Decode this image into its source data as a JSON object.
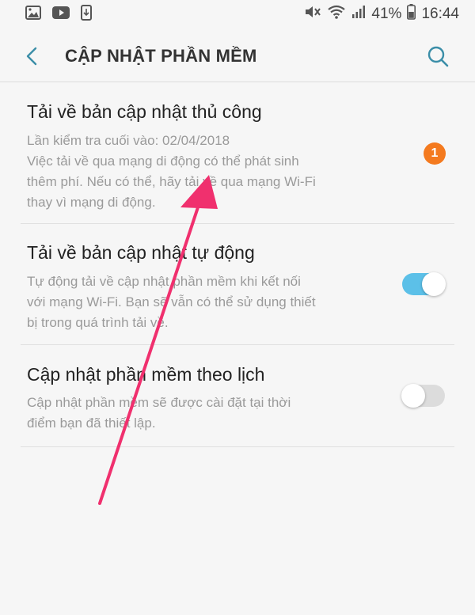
{
  "status_bar": {
    "battery_percent": "41%",
    "time": "16:44",
    "left_icons": [
      "gallery-icon",
      "youtube-icon",
      "update-phone-icon"
    ],
    "right_icons": [
      "mute-icon",
      "wifi-icon",
      "signal-icon",
      "battery-icon"
    ]
  },
  "header": {
    "title": "CẬP NHẬT PHẦN MỀM",
    "back_icon": "back-icon",
    "search_icon": "search-icon"
  },
  "items": [
    {
      "title": "Tải về bản cập nhật thủ công",
      "lines": [
        "Lần kiểm tra cuối vào: 02/04/2018",
        "Việc tải về qua mạng di động có thể phát sinh",
        "thêm phí. Nếu có thể, hãy tải về qua mạng Wi-Fi",
        "thay vì mạng di động."
      ],
      "badge": "1",
      "badge_color": "#f47a1f"
    },
    {
      "title": "Tải về bản cập nhật tự động",
      "lines": [
        "Tự động tải về cập nhật phần mềm khi kết nối",
        "với mạng Wi-Fi. Bạn sẽ vẫn có thể sử dụng thiết",
        "bị trong quá trình tải về."
      ],
      "toggle_on": true
    },
    {
      "title": "Cập nhật phần mềm theo lịch",
      "lines": [
        "Cập nhật phần mềm sẽ được cài đặt tại thời",
        "điểm bạn đã thiết lập."
      ],
      "toggle_on": false
    }
  ],
  "colors": {
    "accent": "#5cc0e8",
    "badge": "#f47a1f",
    "annotation_arrow": "#f0306e",
    "background": "#f6f6f6"
  }
}
